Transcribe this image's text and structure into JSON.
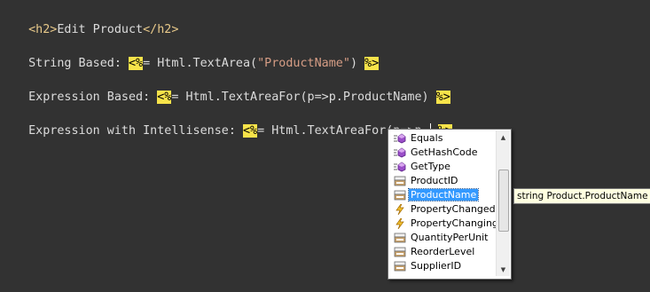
{
  "editor": {
    "line1": {
      "open": "<h2>",
      "text": "Edit Product",
      "close": "</h2>"
    },
    "line2": {
      "label": "String Based: ",
      "delim_open": "<%",
      "equals": "=",
      "code1": " Html.TextArea(",
      "string": "\"ProductName\"",
      "code2": ") ",
      "delim_close": "%>"
    },
    "line3": {
      "label": "Expression Based: ",
      "delim_open": "<%",
      "equals": "=",
      "code": " Html.TextAreaFor(p=>p.ProductName) ",
      "delim_close": "%>"
    },
    "line4": {
      "label": "Expression with Intellisense: ",
      "delim_open": "<%",
      "equals": "=",
      "code": " Html.TextAreaFor(p=>p.",
      "code_after": " ",
      "delim_close": "%>"
    }
  },
  "intellisense": {
    "items": [
      {
        "label": "Equals",
        "icon": "method-icon"
      },
      {
        "label": "GetHashCode",
        "icon": "method-icon"
      },
      {
        "label": "GetType",
        "icon": "method-icon"
      },
      {
        "label": "ProductID",
        "icon": "property-icon"
      },
      {
        "label": "ProductName",
        "icon": "property-icon",
        "selected": true
      },
      {
        "label": "PropertyChanged",
        "icon": "event-icon"
      },
      {
        "label": "PropertyChanging",
        "icon": "event-icon"
      },
      {
        "label": "QuantityPerUnit",
        "icon": "property-icon"
      },
      {
        "label": "ReorderLevel",
        "icon": "property-icon"
      },
      {
        "label": "SupplierID",
        "icon": "property-icon"
      }
    ],
    "tooltip": "string Product.ProductName"
  },
  "colors": {
    "background": "#323232",
    "delimiter_bg": "#f7e34a",
    "selection": "#3399ff",
    "tooltip_bg": "#ffffe1"
  }
}
